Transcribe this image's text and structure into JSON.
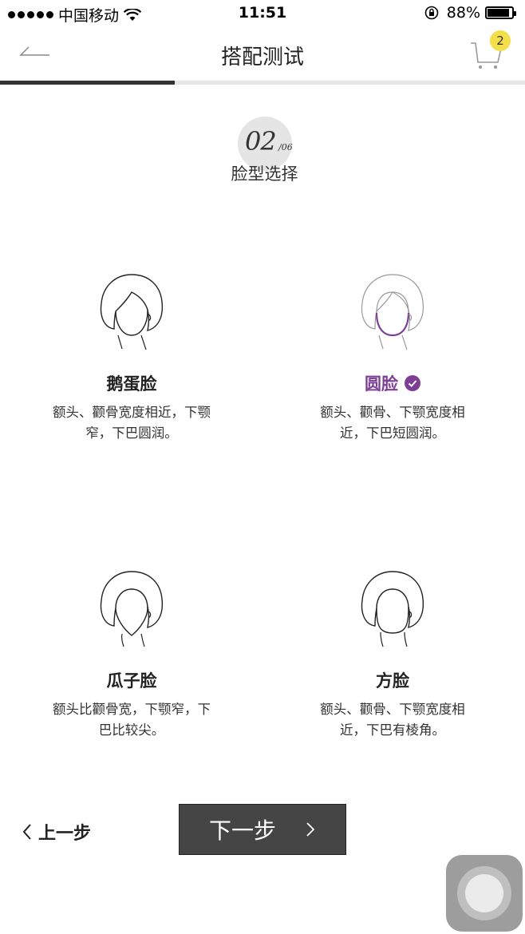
{
  "status_bar": {
    "carrier": "中国移动",
    "time": "11:51",
    "battery": "88%",
    "battery_level": 0.88,
    "signal_icon": "signal-dots-icon",
    "wifi_icon": "wifi-icon",
    "lock_icon": "rotation-lock-icon"
  },
  "header": {
    "title": "搭配测试",
    "back_icon": "back-arrow-icon",
    "cart_icon": "cart-icon",
    "cart_count": "2"
  },
  "progress": {
    "fraction": 0.3333
  },
  "step": {
    "current": "02",
    "total": "/06",
    "title": "脸型选择"
  },
  "options": [
    {
      "title": "鹅蛋脸",
      "desc": "额头、颧骨宽度相近，下颚窄，下巴圆润。",
      "selected": false,
      "icon": "oval-face-icon"
    },
    {
      "title": "圆脸",
      "desc": "额头、颧骨、下颚宽度相近，下巴短圆润。",
      "selected": true,
      "icon": "round-face-icon"
    },
    {
      "title": "瓜子脸",
      "desc": "额头比颧骨宽，下颚窄，下巴比较尖。",
      "selected": false,
      "icon": "heart-face-icon"
    },
    {
      "title": "方脸",
      "desc": "额头、颧骨、下颚宽度相近，下巴有棱角。",
      "selected": false,
      "icon": "square-face-icon"
    }
  ],
  "nav": {
    "prev_label": "上一步",
    "next_label": "下一步"
  },
  "colors": {
    "accent": "#7d3f96",
    "badge": "#f3df4a",
    "button": "#454545"
  }
}
